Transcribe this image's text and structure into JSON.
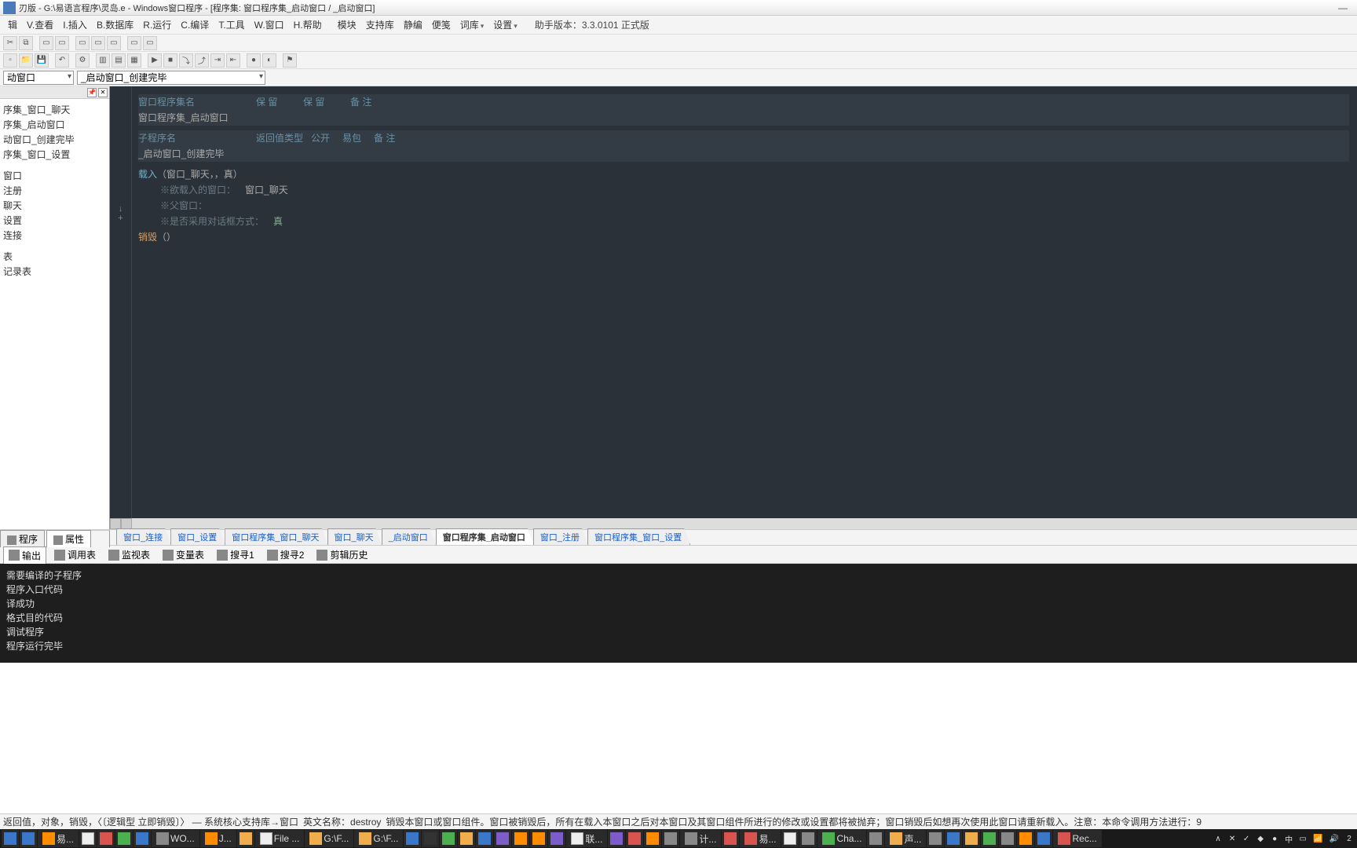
{
  "window": {
    "title": "刃版 - G:\\易语言程序\\灵岛.e - Windows窗口程序 - [程序集: 窗口程序集_启动窗口 / _启动窗口]"
  },
  "menus": {
    "edit": "辑",
    "view": "V.查看",
    "insert": "I.插入",
    "database": "B.数据库",
    "run": "R.运行",
    "compile": "C.编译",
    "tools": "T.工具",
    "window": "W.窗口",
    "help": "H.帮助",
    "module": "模块",
    "support": "支持库",
    "static": "静编",
    "handy": "便笺",
    "dict": "词库",
    "settings": "设置",
    "assistant_label": "助手版本：",
    "assistant_version": "3.3.0101 正式版"
  },
  "combos": {
    "scope": "动窗口",
    "proc": "_启动窗口_创建完毕"
  },
  "tree": {
    "items": [
      "序集_窗口_聊天",
      "序集_启动窗口",
      "动窗口_创建完毕",
      "序集_窗口_设置",
      "",
      "窗口",
      "注册",
      "聊天",
      "设置",
      "连接",
      "",
      "表",
      "记录表"
    ]
  },
  "left_tabs": {
    "program": "程序",
    "props": "属性"
  },
  "code": {
    "header1": {
      "col1": "窗口程序集名",
      "col2": "保 留",
      "col3": "保 留",
      "col4": "备 注"
    },
    "row1": {
      "name": "窗口程序集_启动窗口"
    },
    "header2": {
      "col1": "子程序名",
      "col2": "返回值类型",
      "col3": "公开",
      "col4": "易包",
      "col5": "备 注"
    },
    "row2": {
      "name": "_启动窗口_创建完毕"
    },
    "call1": {
      "fn": "载入",
      "args": "（窗口_聊天，，真）"
    },
    "cmt1": "※欲载入的窗口：",
    "cmt1_val": "窗口_聊天",
    "cmt2": "※父窗口：",
    "cmt3": "※是否采用对话框方式：",
    "cmt3_val": "真",
    "call2": {
      "fn": "销毁",
      "args": "（）"
    }
  },
  "doc_tabs": [
    {
      "label": "窗口_连接",
      "active": false
    },
    {
      "label": "窗口_设置",
      "active": false
    },
    {
      "label": "窗口程序集_窗口_聊天",
      "active": false
    },
    {
      "label": "窗口_聊天",
      "active": false
    },
    {
      "label": "_启动窗口",
      "active": false
    },
    {
      "label": "窗口程序集_启动窗口",
      "active": true
    },
    {
      "label": "窗口_注册",
      "active": false
    },
    {
      "label": "窗口程序集_窗口_设置",
      "active": false
    }
  ],
  "out_tabs": [
    {
      "label": "输出",
      "active": true
    },
    {
      "label": "调用表"
    },
    {
      "label": "监视表"
    },
    {
      "label": "变量表"
    },
    {
      "label": "搜寻1"
    },
    {
      "label": "搜寻2"
    },
    {
      "label": "剪辑历史"
    }
  ],
  "output_lines": [
    "需要编译的子程序",
    "",
    "程序入口代码",
    "译成功",
    "格式目的代码",
    "调试程序",
    "程序运行完毕"
  ],
  "status": {
    "s1": "返回值，对象，销毁，〈〔逻辑型 立即销毁〕〉 — 系统核心支持库→窗口",
    "s2": "英文名称：destroy",
    "s3": "销毁本窗口或窗口组件。窗口被销毁后，所有在载入本窗口之后对本窗口及其窗口组件所进行的修改或设置都将被抛弃；窗口销毁后如想再次使用此窗口请重新载入。注意：本命令调用方法进行：9"
  },
  "taskbar": {
    "items": [
      {
        "name": "start",
        "color": "ic-blue"
      },
      {
        "name": "edge",
        "color": "ic-blue"
      },
      {
        "name": "yi",
        "color": "ic-orange",
        "label": "易..."
      },
      {
        "name": "chrome",
        "color": "ic-white"
      },
      {
        "name": "app1",
        "color": "ic-red"
      },
      {
        "name": "wechat",
        "color": "ic-green"
      },
      {
        "name": "star",
        "color": "ic-blue"
      },
      {
        "name": "wo",
        "color": "ic-gray",
        "label": "WO..."
      },
      {
        "name": "app2",
        "color": "ic-orange",
        "label": "J..."
      },
      {
        "name": "folder",
        "color": "ic-yellow"
      },
      {
        "name": "file",
        "color": "ic-white",
        "label": "File ..."
      },
      {
        "name": "gf1",
        "color": "ic-yellow",
        "label": "G:\\F..."
      },
      {
        "name": "gf2",
        "color": "ic-yellow",
        "label": "G:\\F..."
      },
      {
        "name": "app3",
        "color": "ic-blue"
      },
      {
        "name": "app4",
        "color": "ic-dark"
      },
      {
        "name": "app5",
        "color": "ic-green"
      },
      {
        "name": "app6",
        "color": "ic-yellow"
      },
      {
        "name": "app7",
        "color": "ic-blue"
      },
      {
        "name": "pr",
        "color": "ic-purple"
      },
      {
        "name": "au",
        "color": "ic-orange"
      },
      {
        "name": "ai",
        "color": "ic-orange"
      },
      {
        "name": "pn",
        "color": "ic-purple"
      },
      {
        "name": "lian",
        "color": "ic-white",
        "label": "联..."
      },
      {
        "name": "ae",
        "color": "ic-purple"
      },
      {
        "name": "app8",
        "color": "ic-red"
      },
      {
        "name": "app9",
        "color": "ic-orange"
      },
      {
        "name": "app10",
        "color": "ic-gray"
      },
      {
        "name": "calc",
        "color": "ic-gray",
        "label": "计..."
      },
      {
        "name": "w",
        "color": "ic-red"
      },
      {
        "name": "app11",
        "color": "ic-red",
        "label": "易..."
      },
      {
        "name": "app12",
        "color": "ic-white"
      },
      {
        "name": "app13",
        "color": "ic-gray"
      },
      {
        "name": "cha",
        "color": "ic-green",
        "label": "Cha..."
      },
      {
        "name": "app14",
        "color": "ic-gray"
      },
      {
        "name": "sheng",
        "color": "ic-yellow",
        "label": "声..."
      },
      {
        "name": "app15",
        "color": "ic-gray"
      },
      {
        "name": "app16",
        "color": "ic-blue"
      },
      {
        "name": "app17",
        "color": "ic-yellow"
      },
      {
        "name": "app18",
        "color": "ic-green"
      },
      {
        "name": "app19",
        "color": "ic-gray"
      },
      {
        "name": "app20",
        "color": "ic-orange"
      },
      {
        "name": "app21",
        "color": "ic-blue"
      },
      {
        "name": "rec",
        "color": "ic-red",
        "label": "Rec..."
      }
    ],
    "tray": [
      {
        "name": "up",
        "glyph": "∧"
      },
      {
        "name": "x",
        "glyph": "✕"
      },
      {
        "name": "chk",
        "glyph": "✓"
      },
      {
        "name": "t4",
        "glyph": "◆"
      },
      {
        "name": "t5",
        "glyph": "●"
      },
      {
        "name": "ime",
        "glyph": "中"
      },
      {
        "name": "t6",
        "glyph": "▭"
      },
      {
        "name": "t7",
        "glyph": "📶"
      },
      {
        "name": "t8",
        "glyph": "🔊"
      },
      {
        "name": "clock",
        "glyph": "2"
      }
    ]
  }
}
